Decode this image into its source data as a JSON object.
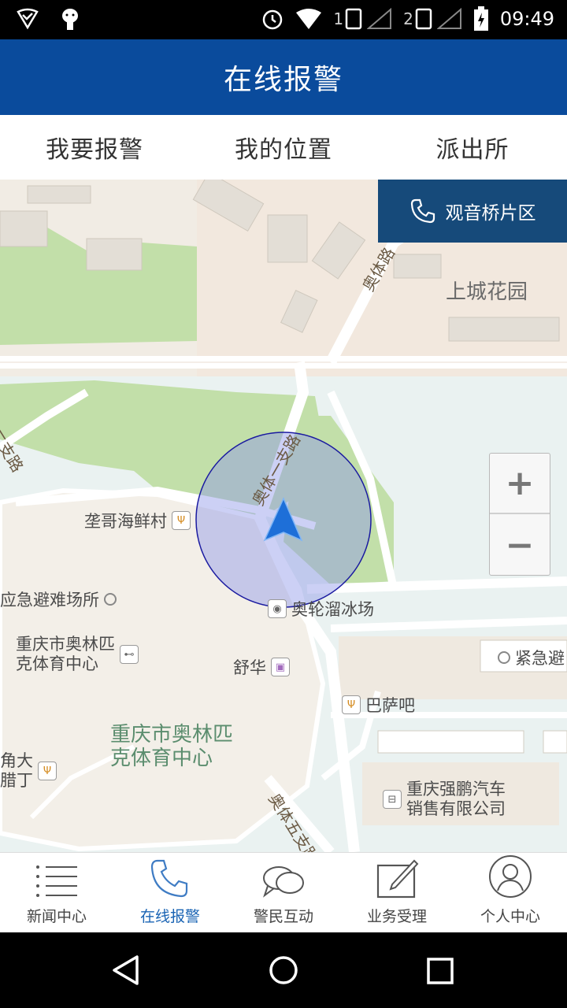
{
  "status_bar": {
    "time": "09:49",
    "sim1": "1",
    "sim2": "2"
  },
  "app_bar": {
    "title": "在线报警"
  },
  "tabs": [
    {
      "label": "我要报警"
    },
    {
      "label": "我的位置"
    },
    {
      "label": "派出所"
    }
  ],
  "map": {
    "station_button": {
      "label": "观音桥片区",
      "icon": "phone-icon"
    },
    "zoom_in": "+",
    "zoom_out": "−",
    "road_labels": [
      "奥体路",
      "奥体一支路",
      "奥体五支路",
      "二支路"
    ],
    "area_labels": [
      "上城花园",
      "重庆市奥林匹\n克体育中心"
    ],
    "pois": [
      {
        "name": "垄哥海鲜村",
        "icon": "restaurant-icon"
      },
      {
        "name": "应急避难场所",
        "icon": "dot-icon"
      },
      {
        "name": "重庆市奥林匹\n克体育中心",
        "icon": "gym-icon"
      },
      {
        "name": "奥轮溜冰场",
        "icon": "sports-icon"
      },
      {
        "name": "舒华",
        "icon": "shopping-icon"
      },
      {
        "name": "紧急避",
        "icon": "dot-icon"
      },
      {
        "name": "巴萨吧",
        "icon": "restaurant-icon"
      },
      {
        "name": "重庆强鹏汽车\n销售有限公司",
        "icon": "car-icon"
      },
      {
        "name": "角大\n腊丁",
        "icon": "restaurant-icon"
      }
    ],
    "colors": {
      "park": "#bfe0a6",
      "accuracy_circle": "#8f97e8",
      "marker": "#1e6fd8"
    }
  },
  "bottom_nav": [
    {
      "label": "新闻中心",
      "icon": "list-icon",
      "active": false
    },
    {
      "label": "在线报警",
      "icon": "phone-icon",
      "active": true
    },
    {
      "label": "警民互动",
      "icon": "chat-icon",
      "active": false
    },
    {
      "label": "业务受理",
      "icon": "edit-icon",
      "active": false
    },
    {
      "label": "个人中心",
      "icon": "user-icon",
      "active": false
    }
  ],
  "colors": {
    "app_bar": "#0a4b9c",
    "active_nav": "#1a64b4",
    "station_button": "#164a7a"
  }
}
